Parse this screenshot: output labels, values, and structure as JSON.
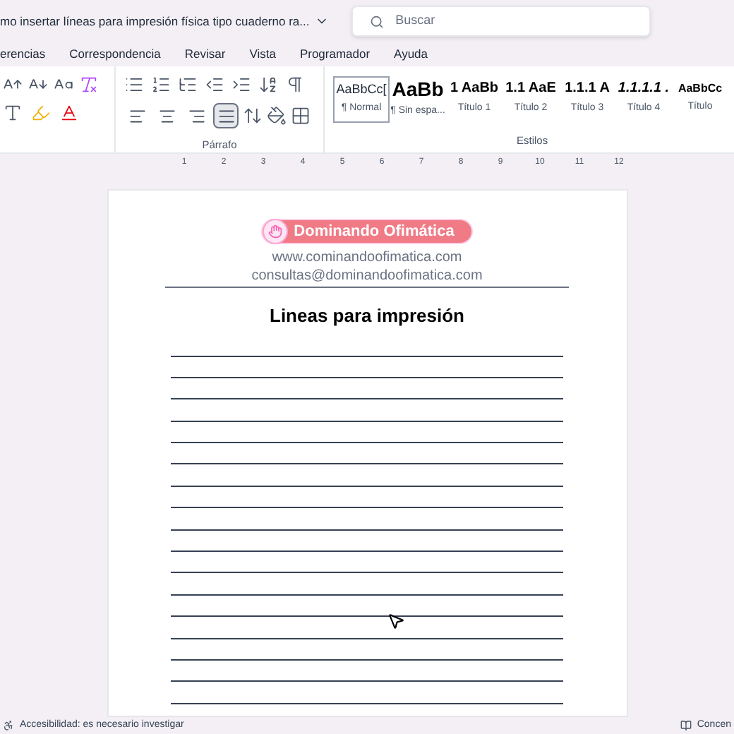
{
  "title_bar": {
    "document_title": "mo insertar líneas para impresión física tipo cuaderno ra...",
    "search": {
      "placeholder": "Buscar"
    }
  },
  "menu_tabs": [
    {
      "label": "erencias",
      "selected": false
    },
    {
      "label": "Correspondencia",
      "selected": false
    },
    {
      "label": "Revisar",
      "selected": false
    },
    {
      "label": "Vista",
      "selected": false
    },
    {
      "label": "Programador",
      "selected": false
    },
    {
      "label": "Ayuda",
      "selected": false
    }
  ],
  "ribbon": {
    "paragraph_group": {
      "label": "Párrafo",
      "alignment": [
        {
          "kind": "left",
          "selected": false
        },
        {
          "kind": "center",
          "selected": false
        },
        {
          "kind": "right",
          "selected": false
        },
        {
          "kind": "justify",
          "selected": true
        }
      ]
    },
    "styles_group": {
      "label": "Estilos",
      "styles": [
        {
          "preview": "AaBbCc[",
          "name": "¶ Normal",
          "kind": "body",
          "selected": true
        },
        {
          "preview": "AaBb",
          "name": "¶ Sin espa...",
          "kind": "large",
          "selected": false
        },
        {
          "preview": "1 AaBb",
          "name": "Título 1",
          "kind": "heading",
          "selected": false
        },
        {
          "preview": "1.1 AaE",
          "name": "Título 2",
          "kind": "heading",
          "selected": false
        },
        {
          "preview": "1.1.1 A",
          "name": "Título 3",
          "kind": "heading",
          "selected": false
        },
        {
          "preview": "1.1.1.1 .",
          "name": "Título 4",
          "kind": "italic",
          "selected": false
        },
        {
          "preview": "AaBbCc",
          "name": "Título",
          "kind": "small",
          "selected": false
        }
      ]
    }
  },
  "ruler": {
    "marks": [
      "1",
      "2",
      "3",
      "4",
      "5",
      "6",
      "7",
      "8",
      "9",
      "10",
      "11",
      "12"
    ]
  },
  "page": {
    "logo_text": "Dominando Ofimática",
    "website": "www.cominandoofimatica.com",
    "email": "consultas@dominandoofimatica.com",
    "heading": "Lineas para impresión"
  },
  "status_bar": {
    "accessibility": "Accesibilidad: es necesario investigar",
    "focus": "Concen"
  }
}
